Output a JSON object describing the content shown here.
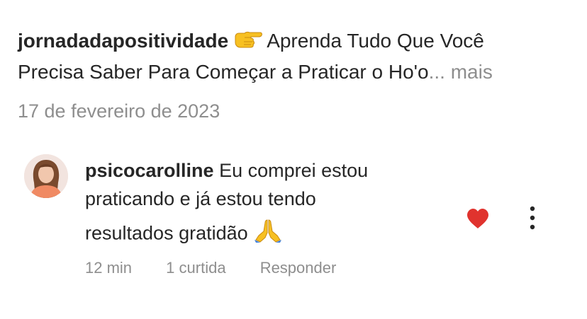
{
  "post": {
    "username": "jornadadapositividade",
    "pointing_emoji_icon": "backhand-index-pointing-right",
    "caption_line1": "Aprenda Tudo Que Você",
    "caption_line2": "Precisa Saber Para Começar a Praticar o Ho'o",
    "ellipsis": "...",
    "more_label": "mais",
    "date": "17 de fevereiro de 2023"
  },
  "comment": {
    "username": "psicocarolline",
    "text_line1": "Eu comprei estou",
    "text_line2": "praticando e já estou tendo",
    "text_line3": "resultados gratidão",
    "prayer_emoji_icon": "folded-hands",
    "time": "12 min",
    "likes": "1 curtida",
    "reply_label": "Responder",
    "liked": true,
    "heart_color": "#e0332e"
  }
}
